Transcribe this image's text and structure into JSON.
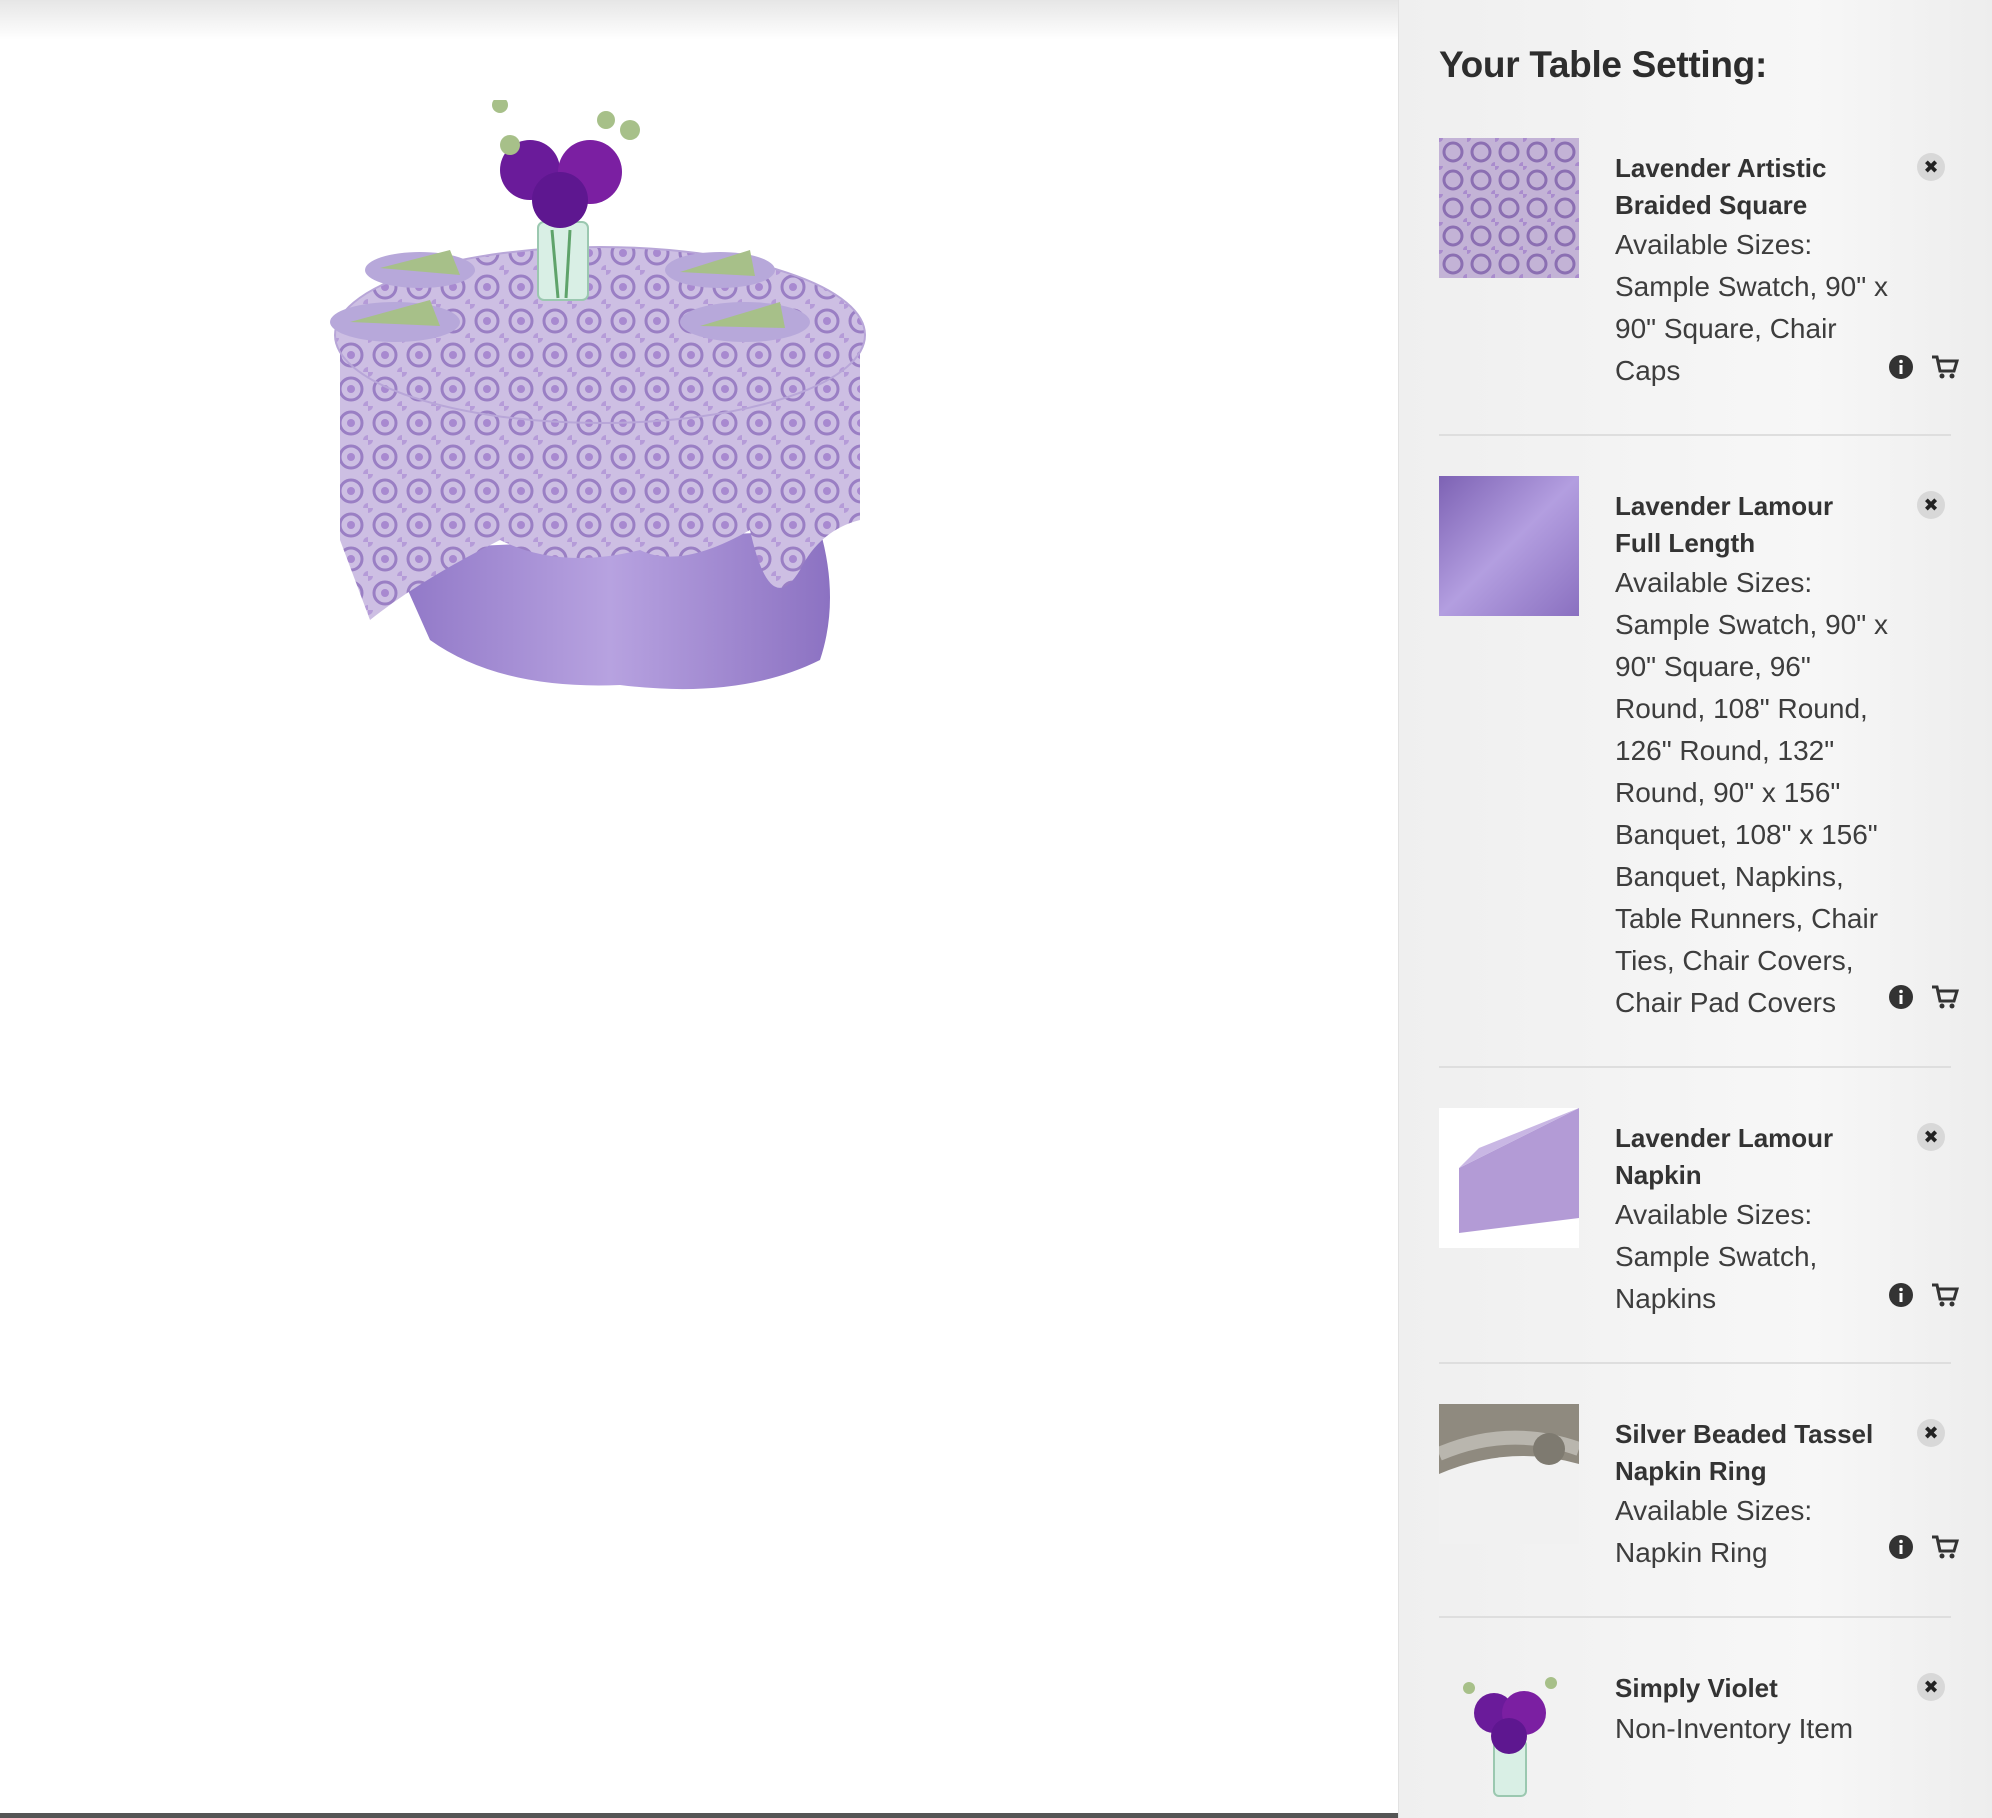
{
  "panel": {
    "title": "Your Table Setting:",
    "items": [
      {
        "name": "Lavender Artistic Braided Square",
        "sizes_label": "Available Sizes:",
        "sizes": "Sample Swatch, 90\" x 90\" Square, Chair Caps",
        "thumb_icon": "lace-swatch-thumbnail"
      },
      {
        "name": "Lavender Lamour Full Length",
        "sizes_label": "Available Sizes:",
        "sizes": "Sample Swatch, 90\" x 90\" Square, 96\" Round, 108\" Round, 126\" Round, 132\" Round, 90\" x 156\" Banquet, 108\" x 156\" Banquet, Napkins, Table Runners, Chair Ties, Chair Covers, Chair Pad Covers",
        "thumb_icon": "satin-swatch-thumbnail"
      },
      {
        "name": "Lavender Lamour Napkin",
        "sizes_label": "Available Sizes:",
        "sizes": "Sample Swatch, Napkins",
        "thumb_icon": "napkin-thumbnail"
      },
      {
        "name": "Silver Beaded Tassel Napkin Ring",
        "sizes_label": "Available Sizes:",
        "sizes": "Napkin Ring",
        "thumb_icon": "napkin-ring-thumbnail"
      },
      {
        "name": "Simply Violet",
        "note": "Non-Inventory Item",
        "thumb_icon": "flower-vase-thumbnail"
      }
    ]
  },
  "colors": {
    "lavender": "#a88fcf",
    "lavender_dark": "#8c6fbd",
    "violet_flower": "#6a1b9a",
    "panel_bg": "#f3f3f3"
  }
}
